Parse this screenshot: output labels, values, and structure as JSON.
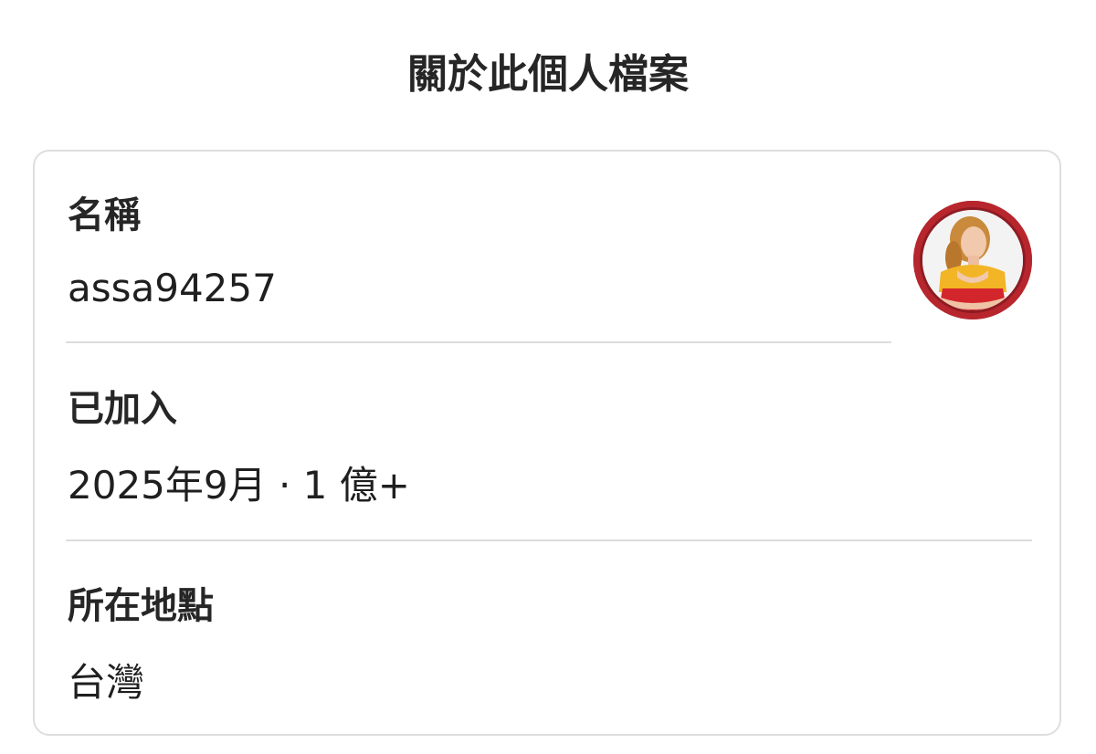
{
  "header": {
    "title": "關於此個人檔案"
  },
  "profile": {
    "name_label": "名稱",
    "name_value": "assa94257",
    "joined_label": "已加入",
    "joined_value": "2025年9月 · 1 億+",
    "location_label": "所在地點",
    "location_value": "台灣",
    "avatar_icon": "profile-avatar-icon"
  },
  "colors": {
    "avatar_ring": "#b8262d",
    "divider": "#dcdcdc",
    "card_border": "#dedede"
  }
}
